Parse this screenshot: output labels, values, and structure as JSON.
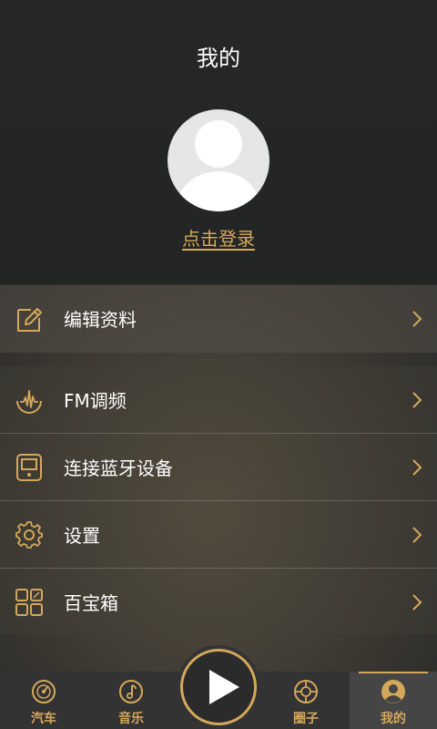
{
  "header": {
    "title": "我的",
    "login_text": "点击登录"
  },
  "menu": {
    "group1": [
      {
        "label": "编辑资料",
        "icon": "edit-profile-icon"
      }
    ],
    "group2": [
      {
        "label": "FM调频",
        "icon": "fm-wave-icon"
      },
      {
        "label": "连接蓝牙设备",
        "icon": "bluetooth-device-icon"
      },
      {
        "label": "设置",
        "icon": "gear-icon"
      },
      {
        "label": "百宝箱",
        "icon": "toolbox-grid-icon"
      }
    ]
  },
  "tabbar": {
    "tabs": [
      {
        "label": "汽车",
        "icon": "speedometer-icon",
        "active": false
      },
      {
        "label": "音乐",
        "icon": "music-note-icon",
        "active": false
      },
      {
        "label": "圈子",
        "icon": "target-circle-icon",
        "active": false
      },
      {
        "label": "我的",
        "icon": "user-icon",
        "active": true
      }
    ],
    "center": {
      "icon": "play-icon"
    }
  },
  "colors": {
    "accent": "#d4a85a",
    "tabbar_bg": "#333333",
    "text": "#ffffff"
  }
}
